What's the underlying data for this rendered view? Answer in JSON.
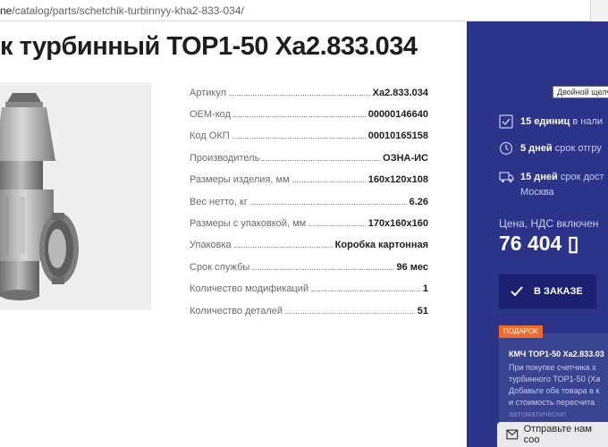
{
  "browser": {
    "url_host": "ne",
    "url_path": "/catalog/parts/schetchik-turbinnyy-kha2-833-034/"
  },
  "page": {
    "title": "к турбинный TOP1-50 Ха2.833.034"
  },
  "specs": [
    {
      "label": "Артикул",
      "value": "Ха2.833.034"
    },
    {
      "label": "ОЕМ-код",
      "value": "00000146640"
    },
    {
      "label": "Код ОКП",
      "value": "00010165158"
    },
    {
      "label": "Производитель",
      "value": "ОЗНА-ИС"
    },
    {
      "label": "Размеры изделия, мм",
      "value": "160x120x108"
    },
    {
      "label": "Вес нетто, кг",
      "value": "6.26"
    },
    {
      "label": "Размеры с упаковкой, мм",
      "value": "170x160x160"
    },
    {
      "label": "Упаковка",
      "value": "Коробка картонная"
    },
    {
      "label": "Срок службы",
      "value": "96 мес"
    },
    {
      "label": "Количество модификаций",
      "value": "1"
    },
    {
      "label": "Количество деталей",
      "value": "51"
    }
  ],
  "sidebar": {
    "tooltip": "Двойной щелч",
    "stock": [
      {
        "icon": "check-box-icon",
        "bold": "15 единиц",
        "text": " в нали",
        "line2": ""
      },
      {
        "icon": "clock-icon",
        "bold": "5 дней",
        "text": " срок отгру",
        "line2": ""
      },
      {
        "icon": "truck-icon",
        "bold": "15 дней",
        "text": " срок дост",
        "line2": "Москва"
      }
    ],
    "price_label": "Цена, НДС включен",
    "price": "76 404 ▯",
    "order_button": "В ЗАКАЗЕ",
    "gift": {
      "badge": "ПОДАРОК",
      "title": "КМЧ TOP1-50 Ха2.833.03",
      "lines": [
        "При покупке счетчика х",
        "турбинного TOP1-50 (Ха",
        "Добавьте оба товара в к",
        "и стоимость пересчита",
        "автоматически!"
      ]
    }
  },
  "chat": {
    "label": "Отправьте нам соо"
  },
  "colors": {
    "sidebar_bg": "#2b3488",
    "button_bg": "#1b2170",
    "badge": "#ef6b2b"
  }
}
